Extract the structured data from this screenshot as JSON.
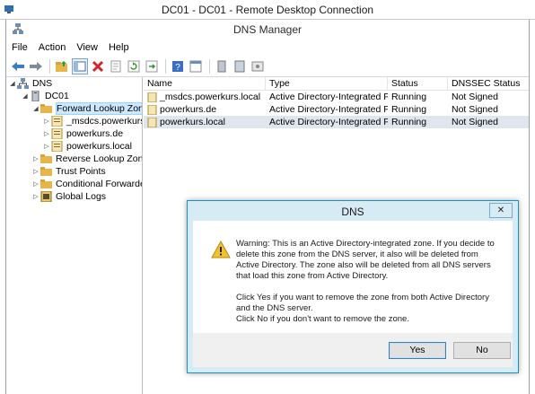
{
  "rdp": {
    "title": "DC01 - DC01 - Remote Desktop Connection"
  },
  "app": {
    "title": "DNS Manager"
  },
  "menu": {
    "items": [
      "File",
      "Action",
      "View",
      "Help"
    ]
  },
  "toolbar": {
    "icons": [
      "back-arrow-icon",
      "forward-arrow-icon",
      "up-folder-icon",
      "show-hide-tree-icon",
      "delete-icon",
      "properties-icon",
      "refresh-icon",
      "export-icon",
      "help-icon",
      "console-icon",
      "server-icon",
      "pane-icon",
      "settings-icon"
    ]
  },
  "tree": {
    "root": "DNS",
    "server": "DC01",
    "forward_zones": "Forward Lookup Zones",
    "zone1": "_msdcs.powerkurs.lo",
    "zone2": "powerkurs.de",
    "zone3": "powerkurs.local",
    "reverse_zones": "Reverse Lookup Zones",
    "trust_points": "Trust Points",
    "conditional_forwarders": "Conditional Forwarders",
    "global_logs": "Global Logs"
  },
  "list": {
    "columns": [
      "Name",
      "Type",
      "Status",
      "DNSSEC Status"
    ],
    "rows": [
      {
        "name": "_msdcs.powerkurs.local",
        "type": "Active Directory-Integrated Pr...",
        "status": "Running",
        "dnssec": "Not Signed"
      },
      {
        "name": "powerkurs.de",
        "type": "Active Directory-Integrated Pr...",
        "status": "Running",
        "dnssec": "Not Signed"
      },
      {
        "name": "powerkurs.local",
        "type": "Active Directory-Integrated Pr...",
        "status": "Running",
        "dnssec": "Not Signed"
      }
    ]
  },
  "dialog": {
    "title": "DNS",
    "close_symbol": "✕",
    "message1": "Warning: This is an Active Directory-integrated zone. If you decide to delete this zone from the DNS server, it also will be deleted from Active Directory. The zone also will be deleted from all DNS servers that load this zone from Active Directory.",
    "message2": "Click Yes if you want to remove the zone from both Active Directory and the DNS server.",
    "message3": "Click No if you don't want to remove the zone.",
    "yes_label": "Yes",
    "no_label": "No"
  },
  "colors": {
    "accent": "#1c8fc9",
    "selection": "#cce8ff",
    "row_alt": "#dfe6ee",
    "folder": "#e8b54a"
  }
}
